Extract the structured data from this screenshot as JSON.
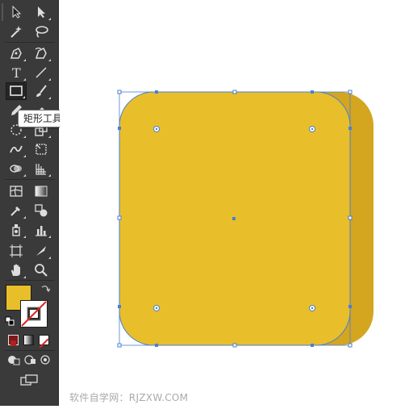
{
  "tooltip": {
    "text": "矩形工具 (M)"
  },
  "watermark": {
    "text": "软件自学网：RJZXW.COM"
  },
  "toolbar": {
    "tools": [
      {
        "name": "selection-tool",
        "icon": "selection-arrow-icon",
        "active": false
      },
      {
        "name": "direct-selection-tool",
        "icon": "direct-selection-arrow-icon",
        "active": false
      },
      {
        "name": "magic-wand-tool",
        "icon": "magic-wand-icon",
        "active": false
      },
      {
        "name": "lasso-tool",
        "icon": "lasso-icon",
        "active": false
      },
      {
        "name": "pen-tool",
        "icon": "pen-icon",
        "active": false
      },
      {
        "name": "curvature-tool",
        "icon": "curvature-pen-icon",
        "active": false
      },
      {
        "name": "type-tool",
        "icon": "type-icon",
        "active": false
      },
      {
        "name": "line-segment-tool",
        "icon": "line-segment-icon",
        "active": false
      },
      {
        "name": "rectangle-tool",
        "icon": "rectangle-icon",
        "active": true
      },
      {
        "name": "paintbrush-tool",
        "icon": "paintbrush-icon",
        "active": false
      },
      {
        "name": "pencil-tool",
        "icon": "pencil-icon",
        "active": false
      },
      {
        "name": "eraser-tool",
        "icon": "eraser-icon",
        "active": false
      },
      {
        "name": "rotate-tool",
        "icon": "rotate-icon",
        "active": false
      },
      {
        "name": "scale-tool",
        "icon": "scale-icon",
        "active": false
      },
      {
        "name": "warp-tool",
        "icon": "warp-icon",
        "active": false
      },
      {
        "name": "free-transform-tool",
        "icon": "free-transform-icon",
        "active": false
      },
      {
        "name": "shape-builder-tool",
        "icon": "shape-builder-icon",
        "active": false
      },
      {
        "name": "perspective-grid-tool",
        "icon": "perspective-grid-icon",
        "active": false
      },
      {
        "name": "mesh-tool",
        "icon": "mesh-icon",
        "active": false
      },
      {
        "name": "gradient-tool",
        "icon": "gradient-icon",
        "active": false
      },
      {
        "name": "eyedropper-tool",
        "icon": "eyedropper-icon",
        "active": false
      },
      {
        "name": "blend-tool",
        "icon": "blend-icon",
        "active": false
      },
      {
        "name": "symbol-sprayer-tool",
        "icon": "symbol-sprayer-icon",
        "active": false
      },
      {
        "name": "column-graph-tool",
        "icon": "column-graph-icon",
        "active": false
      },
      {
        "name": "artboard-tool",
        "icon": "artboard-icon",
        "active": false
      },
      {
        "name": "slice-tool",
        "icon": "slice-icon",
        "active": false
      },
      {
        "name": "hand-tool",
        "icon": "hand-icon",
        "active": false
      },
      {
        "name": "zoom-tool",
        "icon": "zoom-icon",
        "active": false
      }
    ],
    "fill_color": "#e8bf2a",
    "stroke_color": "none"
  },
  "canvas": {
    "shape_fill": "#e8bf2a",
    "shadow_fill": "#d4a51f",
    "selection_color": "#4a7fd6"
  }
}
